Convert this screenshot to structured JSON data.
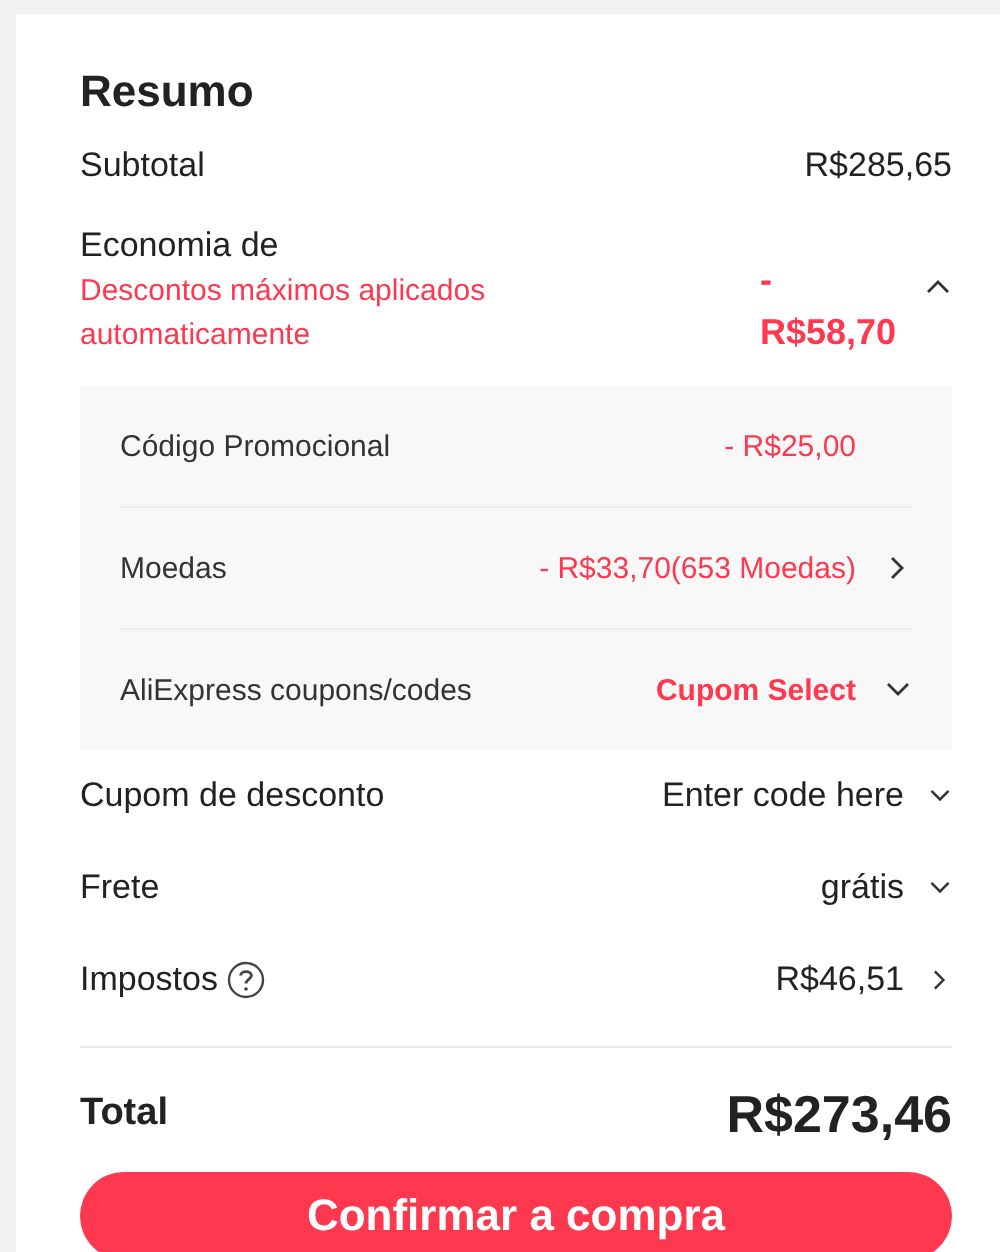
{
  "title": "Resumo",
  "subtotal": {
    "label": "Subtotal",
    "value": "R$285,65"
  },
  "savings": {
    "label": "Economia de",
    "note": "Descontos máximos aplicados automaticamente",
    "value": "- R$58,70",
    "expanded": true,
    "items": [
      {
        "label": "Código Promocional",
        "value": "- R$25,00",
        "kind": "amount"
      },
      {
        "label": "Moedas",
        "value": "- R$33,70(653 Moedas)",
        "kind": "link"
      },
      {
        "label": "AliExpress coupons/codes",
        "value": "Cupom Select",
        "kind": "select"
      }
    ]
  },
  "rows": [
    {
      "label": "Cupom de desconto",
      "value": "Enter code here",
      "kind": "select"
    },
    {
      "label": "Frete",
      "value": "grátis",
      "kind": "select"
    },
    {
      "label": "Impostos",
      "value": "R$46,51",
      "kind": "info"
    }
  ],
  "total": {
    "label": "Total",
    "value": "R$273,46"
  },
  "button": "Confirmar a compra"
}
